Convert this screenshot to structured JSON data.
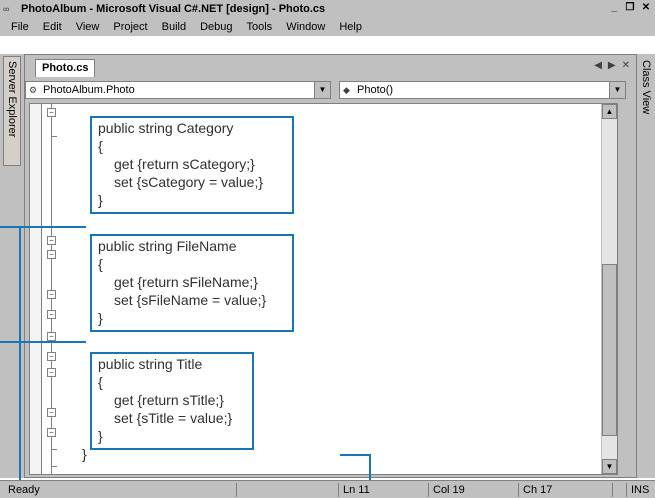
{
  "window": {
    "title": "PhotoAlbum - Microsoft Visual C#.NET [design] - Photo.cs",
    "icon": "vs-app-icon",
    "buttons": [
      "_",
      "&#9633;",
      "×"
    ]
  },
  "menu": [
    "File",
    "Edit",
    "View",
    "Project",
    "Build",
    "Debug",
    "Tools",
    "Window",
    "Help"
  ],
  "side_tabs": {
    "left": "Server Explorer",
    "right": "Class View"
  },
  "document": {
    "tab_label": "Photo.cs",
    "tab_nav": [
      "◀",
      "▶",
      "×"
    ],
    "class_combo": "PhotoAlbum.Photo",
    "member_combo": "Photo()"
  },
  "code": {
    "category": {
      "decl": "public string Category",
      "open": "{",
      "get": "get {return sCategory;}",
      "set": "set {sCategory = value;}",
      "close": "}"
    },
    "filename": {
      "decl": "public string FileName",
      "open": "{",
      "get": "get {return sFileName;}",
      "set": "set {sFileName = value;}",
      "close": "}"
    },
    "title": {
      "decl": "public string Title",
      "open": "{",
      "get": "get {return sTitle;}",
      "set": "set {sTitle = value;}",
      "close": "}"
    },
    "outer_close": "}"
  },
  "status": {
    "ready": "Ready",
    "ln": "Ln 11",
    "col": "Col 19",
    "ch": "Ch 17",
    "ins": "INS"
  },
  "colors": {
    "callout": "#1a75b5",
    "chrome": "#c0c0c0"
  }
}
